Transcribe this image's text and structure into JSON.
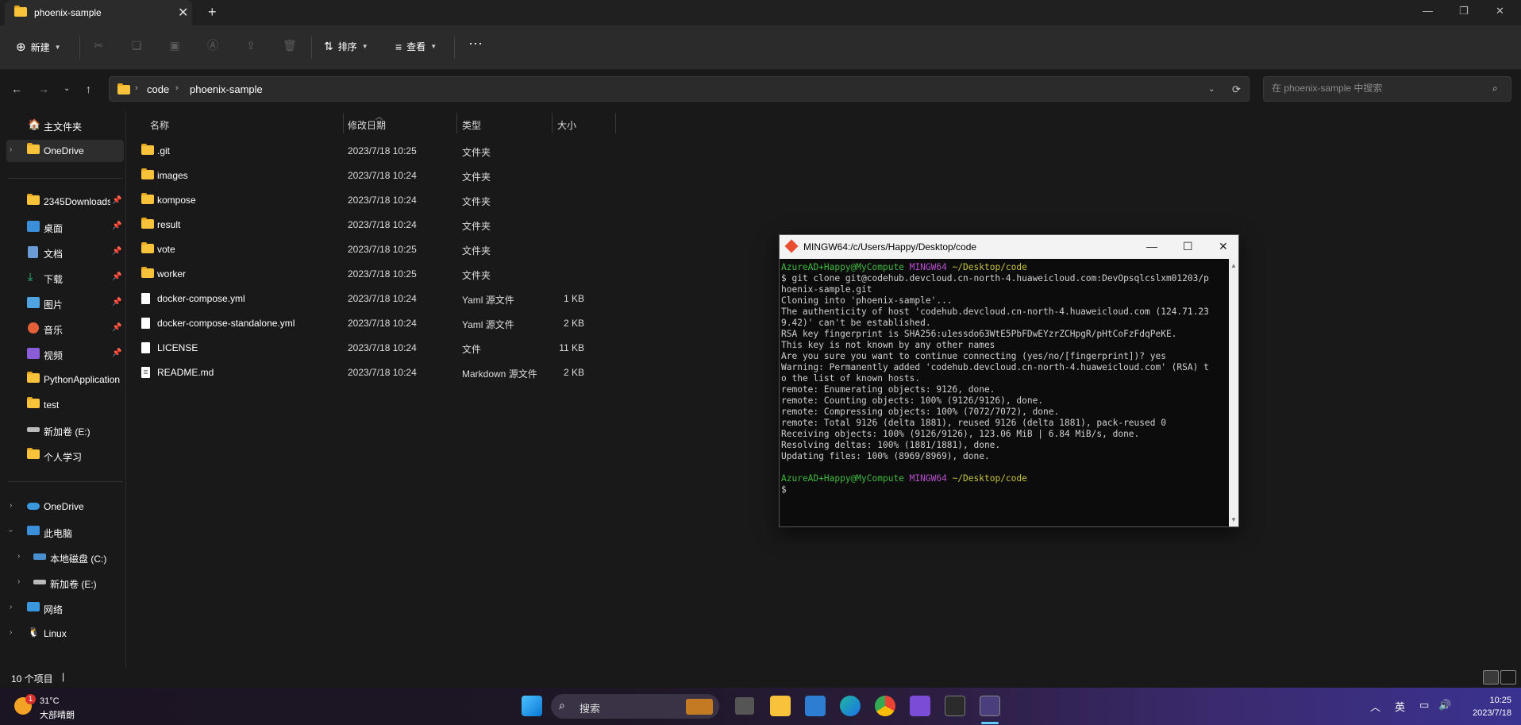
{
  "tab": {
    "title": "phoenix-sample"
  },
  "toolbar": {
    "new_label": "新建",
    "sort_label": "排序",
    "view_label": "查看"
  },
  "address": {
    "crumbs": [
      "code",
      "phoenix-sample"
    ]
  },
  "search": {
    "placeholder": "在 phoenix-sample 中搜索"
  },
  "sidebar": {
    "quick": [
      {
        "label": "主文件夹"
      },
      {
        "label": "OneDrive"
      }
    ],
    "pinned": [
      {
        "label": "2345Downloads"
      },
      {
        "label": "桌面"
      },
      {
        "label": "文档"
      },
      {
        "label": "下载"
      },
      {
        "label": "图片"
      },
      {
        "label": "音乐"
      },
      {
        "label": "视频"
      },
      {
        "label": "PythonApplication"
      },
      {
        "label": "test"
      },
      {
        "label": "新加卷 (E:)"
      },
      {
        "label": "个人学习"
      }
    ],
    "tree": [
      {
        "label": "OneDrive"
      },
      {
        "label": "此电脑"
      },
      {
        "label": "本地磁盘 (C:)"
      },
      {
        "label": "新加卷 (E:)"
      },
      {
        "label": "网络"
      },
      {
        "label": "Linux"
      }
    ]
  },
  "columns": {
    "name": "名称",
    "date": "修改日期",
    "type": "类型",
    "size": "大小"
  },
  "files": [
    {
      "name": ".git",
      "date": "2023/7/18 10:25",
      "type": "文件夹",
      "size": "",
      "kind": "folder"
    },
    {
      "name": "images",
      "date": "2023/7/18 10:24",
      "type": "文件夹",
      "size": "",
      "kind": "folder"
    },
    {
      "name": "kompose",
      "date": "2023/7/18 10:24",
      "type": "文件夹",
      "size": "",
      "kind": "folder"
    },
    {
      "name": "result",
      "date": "2023/7/18 10:24",
      "type": "文件夹",
      "size": "",
      "kind": "folder"
    },
    {
      "name": "vote",
      "date": "2023/7/18 10:25",
      "type": "文件夹",
      "size": "",
      "kind": "folder"
    },
    {
      "name": "worker",
      "date": "2023/7/18 10:25",
      "type": "文件夹",
      "size": "",
      "kind": "folder"
    },
    {
      "name": "docker-compose.yml",
      "date": "2023/7/18 10:24",
      "type": "Yaml 源文件",
      "size": "1 KB",
      "kind": "file"
    },
    {
      "name": "docker-compose-standalone.yml",
      "date": "2023/7/18 10:24",
      "type": "Yaml 源文件",
      "size": "2 KB",
      "kind": "file"
    },
    {
      "name": "LICENSE",
      "date": "2023/7/18 10:24",
      "type": "文件",
      "size": "11 KB",
      "kind": "file"
    },
    {
      "name": "README.md",
      "date": "2023/7/18 10:24",
      "type": "Markdown 源文件",
      "size": "2 KB",
      "kind": "doc"
    }
  ],
  "status": {
    "count": "10 个项目"
  },
  "terminal": {
    "title": "MINGW64:/c/Users/Happy/Desktop/code",
    "prompt_user": "AzureAD+Happy@MyCompute",
    "prompt_sys": "MINGW64",
    "prompt_path": "~/Desktop/code",
    "lines": [
      "$ git clone git@codehub.devcloud.cn-north-4.huaweicloud.com:DevOpsqlcslxm01203/p",
      "hoenix-sample.git",
      "Cloning into 'phoenix-sample'...",
      "The authenticity of host 'codehub.devcloud.cn-north-4.huaweicloud.com (124.71.23",
      "9.42)' can't be established.",
      "RSA key fingerprint is SHA256:u1essdo63WtE5PbFDwEYzrZCHpgR/pHtCoFzFdqPeKE.",
      "This key is not known by any other names",
      "Are you sure you want to continue connecting (yes/no/[fingerprint])? yes",
      "Warning: Permanently added 'codehub.devcloud.cn-north-4.huaweicloud.com' (RSA) t",
      "o the list of known hosts.",
      "remote: Enumerating objects: 9126, done.",
      "remote: Counting objects: 100% (9126/9126), done.",
      "remote: Compressing objects: 100% (7072/7072), done.",
      "remote: Total 9126 (delta 1881), reused 9126 (delta 1881), pack-reused 0",
      "Receiving objects: 100% (9126/9126), 123.06 MiB | 6.84 MiB/s, done.",
      "Resolving deltas: 100% (1881/1881), done.",
      "Updating files: 100% (8969/8969), done."
    ],
    "final_prompt": "$"
  },
  "taskbar": {
    "weather_temp": "31°C",
    "weather_desc": "大部晴朗",
    "weather_badge": "1",
    "search_label": "搜索",
    "ime": "英",
    "time": "10:25",
    "date": "2023/7/18"
  },
  "colors": {
    "folder": "#f8c33a",
    "accent": "#60cdff",
    "prompt_green": "#3fb93f",
    "prompt_magenta": "#b94fd0",
    "prompt_yellow": "#c7c43d"
  }
}
